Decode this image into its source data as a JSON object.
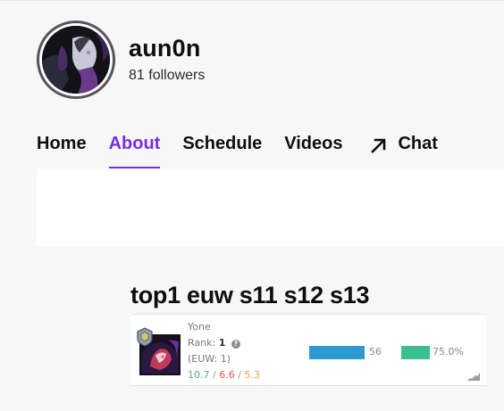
{
  "channel": {
    "name": "aun0n",
    "followers": "81 followers"
  },
  "nav": {
    "tabs": [
      {
        "label": "Home"
      },
      {
        "label": "About"
      },
      {
        "label": "Schedule"
      },
      {
        "label": "Videos"
      },
      {
        "label": "Chat",
        "icon": "external-arrow-icon"
      }
    ],
    "active_tab": "About"
  },
  "about": {
    "title": "top1 euw s11 s12 s13"
  },
  "stats": {
    "champion": "Yone",
    "rank_label": "Rank:",
    "rank_value": "1",
    "region_rank": "(EUW: 1)",
    "kills": "10.7",
    "deaths": "6.6",
    "assists": "5.3",
    "kda_separator": "/",
    "games": "56",
    "games_bar_fraction": 1.0,
    "winrate": "75.0%",
    "winrate_fraction": 0.75,
    "colors": {
      "games_bar": "#2d9ad3",
      "winrate_bar": "#3bbf8c",
      "kills": "#4eb07c",
      "deaths": "#e0534a",
      "assists": "#e6a435",
      "accent": "#772ce8"
    }
  }
}
